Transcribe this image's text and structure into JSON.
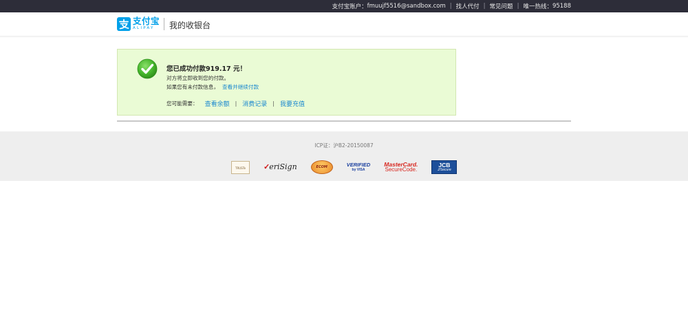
{
  "topbar": {
    "account_label": "支付宝账户：",
    "account_email": "fmuujf5516@sandbox.com",
    "proxy_pay": "找人代付",
    "faq": "常见问题",
    "hotline_label": "唯一热线：",
    "hotline_number": "95188"
  },
  "header": {
    "logo_cn": "支付宝",
    "logo_en": "ALIPAY",
    "subtitle": "我的收银台"
  },
  "success": {
    "title": "您已成功付款919.17 元！",
    "line1": "对方将立即收到您的付款。",
    "line2_text": "如果您有未付款信息，",
    "continue_link": "查看并继续付款",
    "needs_label": "您可能需要：",
    "links": [
      "查看余额",
      "消费记录",
      "我要充值"
    ],
    "separator": "|"
  },
  "footer": {
    "icp": "ICP证：沪B2-20150087",
    "certs": {
      "trust": "TRUSTe",
      "verisign_check": "✓",
      "verisign": "eriSign",
      "ecom": "ECOM",
      "visa_line1": "VERIFIED",
      "visa_line2": "by VISA",
      "mc_line1": "MasterCard.",
      "mc_line2": "SecureCode.",
      "jcb_line1": "JCB",
      "jcb_line2": "J/Secure"
    }
  },
  "colors": {
    "topbar_bg": "#2d2d39",
    "brand_blue": "#00a0e9",
    "success_bg": "#eafbd5",
    "link_blue": "#1b88cf",
    "success_green": "#4caf30",
    "footer_bg": "#eeeeee"
  }
}
